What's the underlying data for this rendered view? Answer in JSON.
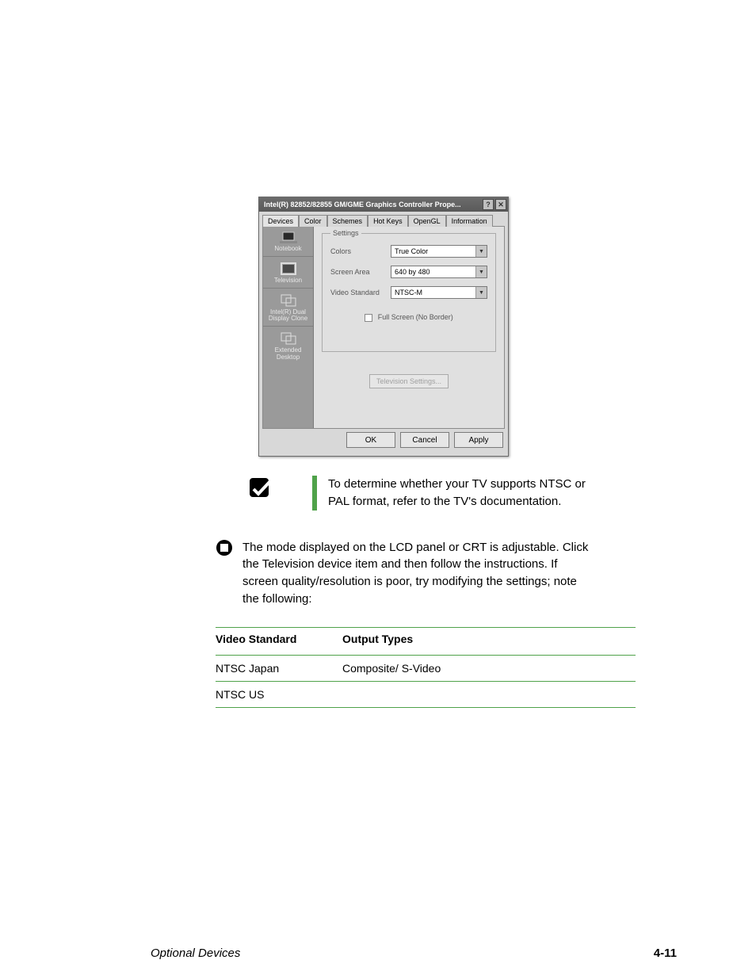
{
  "dialog": {
    "title": "Intel(R) 82852/82855 GM/GME Graphics Controller Prope...",
    "tabs": [
      "Devices",
      "Color",
      "Schemes",
      "Hot Keys",
      "OpenGL",
      "Information"
    ],
    "active_tab": 0,
    "sidebar": [
      {
        "label": "Notebook",
        "icon": "laptop-icon"
      },
      {
        "label": "Television",
        "icon": "tv-icon"
      },
      {
        "label": "Intel(R) Dual Display Clone",
        "icon": "clone-icon"
      },
      {
        "label": "Extended Desktop",
        "icon": "extend-icon"
      }
    ],
    "settings_legend": "Settings",
    "rows": {
      "colors": {
        "label": "Colors",
        "value": "True Color"
      },
      "screen_area": {
        "label": "Screen Area",
        "value": "640 by 480"
      },
      "video_standard": {
        "label": "Video Standard",
        "value": "NTSC-M"
      }
    },
    "checkbox_label": "Full Screen (No Border)",
    "tv_btn": "Television Settings...",
    "footer": {
      "ok": "OK",
      "cancel": "Cancel",
      "apply": "Apply"
    },
    "help_icon": "?",
    "close_icon": "✕"
  },
  "tip": "To determine whether your TV supports NTSC or PAL format, refer to the TV's documentation.",
  "section_text": "The mode displayed on the LCD panel or CRT is adjustable. Click the Television device item and then follow the instructions. If screen quality/resolution is poor, try modifying the settings; note the following:",
  "table": {
    "head": {
      "c1": "Video Standard",
      "c2": "Output Types"
    },
    "rows": [
      {
        "c1": "NTSC Japan",
        "c2": "Composite/ S-Video"
      },
      {
        "c1": "NTSC US",
        "c2": ""
      }
    ]
  },
  "footer": {
    "left": "Optional Devices",
    "right": "4-11"
  }
}
